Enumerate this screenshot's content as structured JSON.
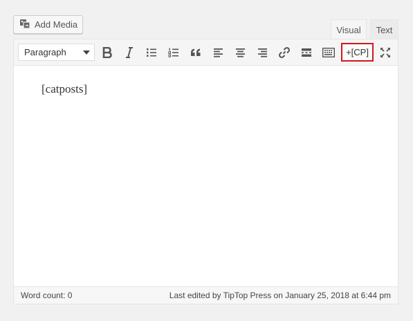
{
  "media": {
    "add_media_label": "Add Media"
  },
  "tabs": [
    {
      "label": "Visual"
    },
    {
      "label": "Text"
    }
  ],
  "toolbar": {
    "format_value": "Paragraph",
    "cp_label": "+[CP]",
    "icons": [
      "bold-icon",
      "italic-icon",
      "bullet-list-icon",
      "numbered-list-icon",
      "blockquote-icon",
      "align-left-icon",
      "align-center-icon",
      "align-right-icon",
      "link-icon",
      "read-more-icon",
      "toolbar-toggle-icon",
      "fullscreen-icon"
    ]
  },
  "editor": {
    "content": "[catposts]"
  },
  "status": {
    "word_count": "Word count: 0",
    "last_edited": "Last edited by TipTop Press on January 25, 2018 at 6:44 pm"
  },
  "colors": {
    "highlight_border": "#d5151c",
    "toolbar_bg": "#f5f5f5",
    "page_bg": "#f1f1f1"
  }
}
